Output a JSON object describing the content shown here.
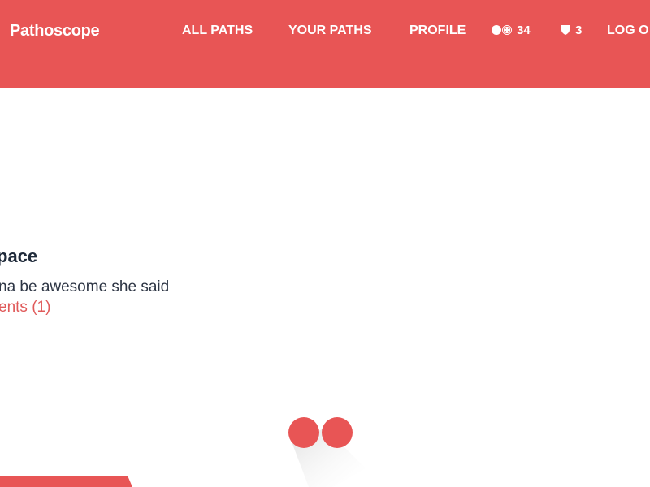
{
  "header": {
    "brand": "Pathoscope",
    "nav": {
      "all_paths": "ALL PATHS",
      "your_paths": "YOUR PATHS",
      "profile": "PROFILE",
      "logout": "LOG O"
    },
    "stats": {
      "dots_count": "34",
      "badge_count": "3"
    },
    "colors": {
      "brand_red": "#e85555",
      "link_red": "#e05a5a",
      "text_dark": "#1f2a3a"
    }
  },
  "post": {
    "title": "pace",
    "body": "na be awesome she said",
    "comments_link": "ents (1)"
  },
  "icons": {
    "stats_dots": "dots-icon",
    "badge": "shield-icon",
    "logo": "pathoscope-dots-logo"
  }
}
